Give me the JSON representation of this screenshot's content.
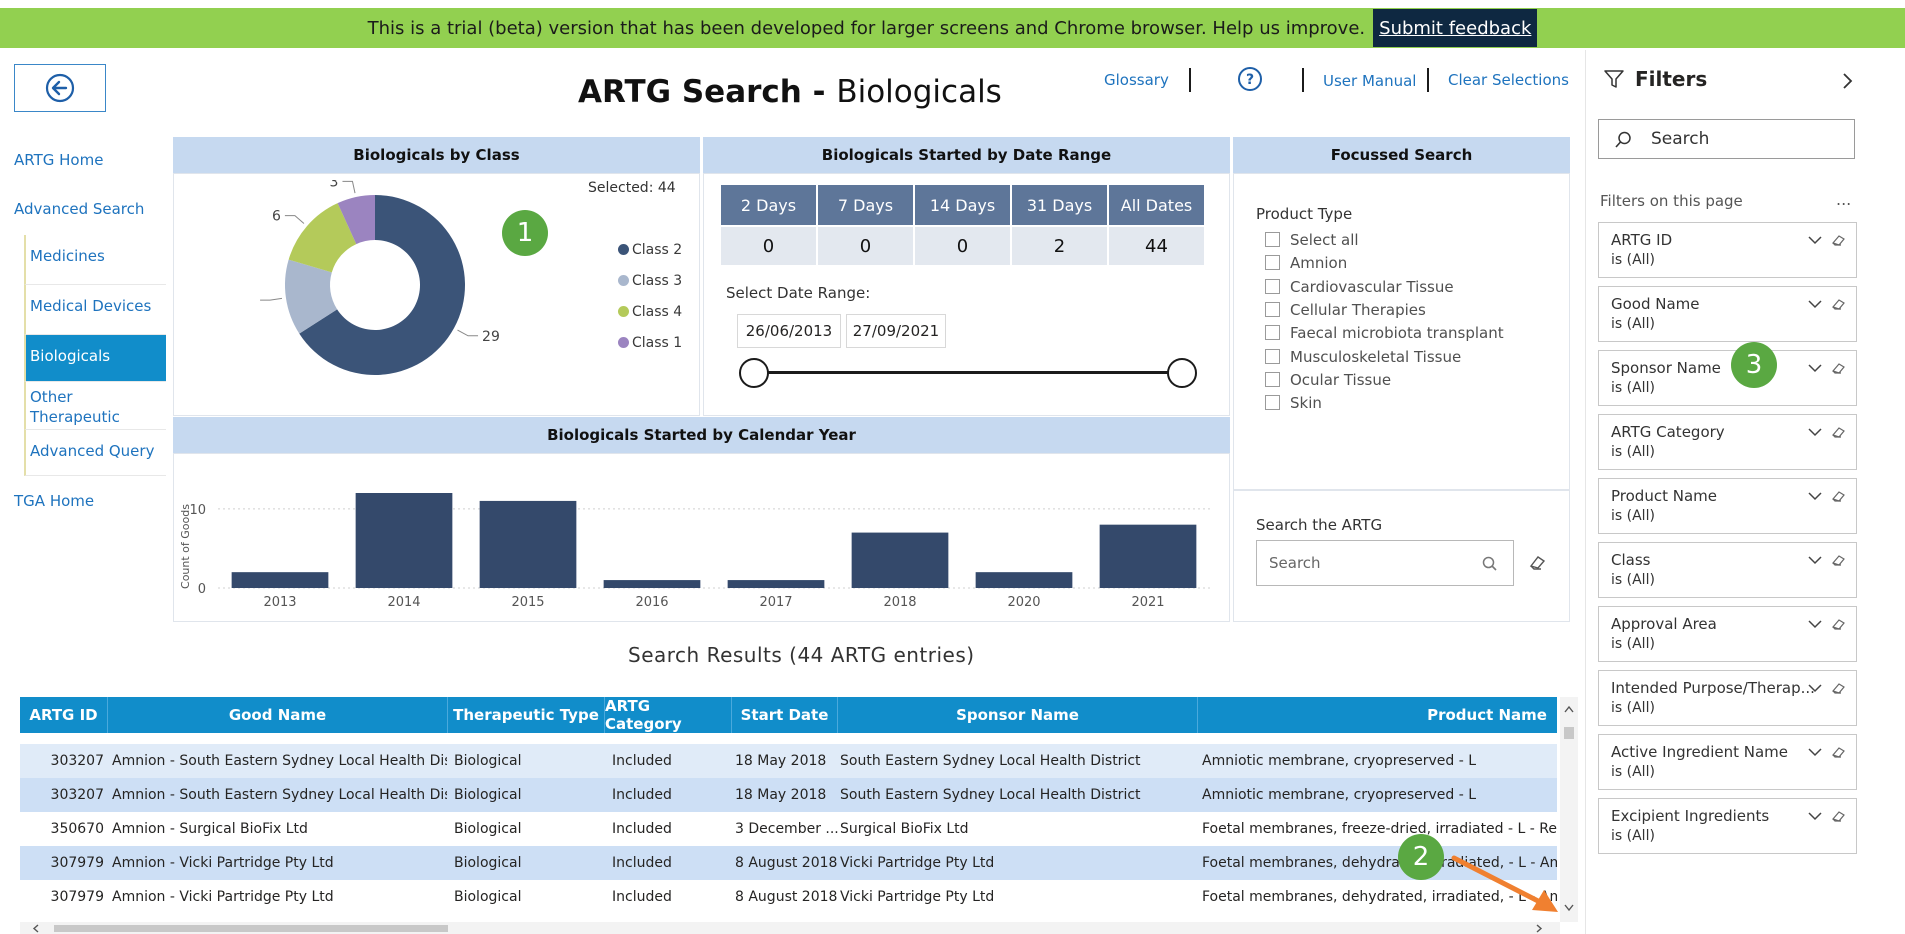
{
  "banner": {
    "text": "This is a trial (beta) version that has been developed for larger screens and Chrome browser. Help us improve.",
    "feedback_label": "Submit feedback"
  },
  "nav": {
    "artg_home": "ARTG Home",
    "advanced_search": "Advanced Search",
    "medicines": "Medicines",
    "medical_devices": "Medical Devices",
    "biologicals": "Biologicals",
    "other_goods": "Other Therapeutic Goods",
    "advanced_query": "Advanced Query",
    "tga_home": "TGA Home"
  },
  "header": {
    "title_bold": "ARTG Search - ",
    "title_rest": "Biologicals",
    "glossary": "Glossary",
    "user_manual": "User Manual",
    "clear_selections": "Clear Selections"
  },
  "by_class": {
    "title": "Biologicals by Class",
    "selected": "Selected: 44",
    "chart_data": {
      "type": "pie",
      "categories": [
        "Class 2",
        "Class 3",
        "Class 4",
        "Class 1"
      ],
      "values": [
        29,
        6,
        6,
        3
      ],
      "colors": [
        "#3b5478",
        "#a9b7cd",
        "#b4ca5a",
        "#9b84c0"
      ]
    }
  },
  "date_range": {
    "title": "Biologicals Started by Date Range",
    "headers": [
      "2 Days",
      "7 Days",
      "14 Days",
      "31 Days",
      "All Dates"
    ],
    "values": [
      "0",
      "0",
      "0",
      "2",
      "44"
    ],
    "select_label": "Select Date Range:",
    "start": "26/06/2013",
    "end": "27/09/2021"
  },
  "by_year": {
    "title": "Biologicals Started by Calendar Year",
    "chart_data": {
      "type": "bar",
      "categories": [
        "2013",
        "2014",
        "2015",
        "2016",
        "2017",
        "2018",
        "2020",
        "2021"
      ],
      "values": [
        2,
        12,
        11,
        1,
        1,
        7,
        2,
        8
      ],
      "ylabel": "Count of Goods",
      "yticks": [
        "0",
        "10"
      ],
      "ylim": [
        0,
        12
      ]
    }
  },
  "focussed": {
    "title": "Focussed Search",
    "product_type_label": "Product Type",
    "options": [
      "Select all",
      "Amnion",
      "Cardiovascular Tissue",
      "Cellular Therapies",
      "Faecal microbiota transplant",
      "Musculoskeletal Tissue",
      "Ocular Tissue",
      "Skin"
    ],
    "search_label": "Search the ARTG",
    "search_placeholder": "Search"
  },
  "results": {
    "title": "Search Results (44 ARTG entries)",
    "columns": [
      "ARTG ID",
      "Good Name",
      "Therapeutic Type",
      "ARTG Category",
      "Start Date",
      "Sponsor Name",
      "Product Name"
    ],
    "rows": [
      [
        "303207",
        "Amnion - South Eastern Sydney Local Health Dist...",
        "Biological",
        "Included",
        "18 May 2018",
        "South Eastern Sydney Local Health District",
        "Amniotic membrane, cryopreserved - L"
      ],
      [
        "303207",
        "Amnion - South Eastern Sydney Local Health Dist...",
        "Biological",
        "Included",
        "18 May 2018",
        "South Eastern Sydney Local Health District",
        "Amniotic membrane, cryopreserved - L"
      ],
      [
        "350670",
        "Amnion - Surgical BioFix Ltd",
        "Biological",
        "Included",
        "3 December ...",
        "Surgical BioFix Ltd",
        "Foetal membranes, freeze-dried, irradiated - L - Revita"
      ],
      [
        "307979",
        "Amnion - Vicki Partridge Pty Ltd",
        "Biological",
        "Included",
        "8 August 2018",
        "Vicki Partridge Pty Ltd",
        "Foetal membranes, dehydrated, irradiated, - L - Amnio"
      ],
      [
        "307979",
        "Amnion - Vicki Partridge Pty Ltd",
        "Biological",
        "Included",
        "8 August 2018",
        "Vicki Partridge Pty Ltd",
        "Foetal membranes, dehydrated, irradiated, - L - Amnio"
      ]
    ]
  },
  "filters": {
    "title": "Filters",
    "search_placeholder": "Search",
    "section_label": "Filters on this page",
    "more": "...",
    "items": [
      {
        "name": "ARTG ID",
        "value": "is (All)"
      },
      {
        "name": "Good Name",
        "value": "is (All)"
      },
      {
        "name": "Sponsor Name",
        "value": "is (All)"
      },
      {
        "name": "ARTG Category",
        "value": "is (All)"
      },
      {
        "name": "Product Name",
        "value": "is (All)"
      },
      {
        "name": "Class",
        "value": "is (All)"
      },
      {
        "name": "Approval Area",
        "value": "is (All)"
      },
      {
        "name": "Intended Purpose/Therap...",
        "value": "is (All)"
      },
      {
        "name": "Active Ingredient Name",
        "value": "is (All)"
      },
      {
        "name": "Excipient Ingredients",
        "value": "is (All)"
      }
    ]
  },
  "badges": [
    "1",
    "2",
    "3"
  ],
  "colors": {
    "banner": "#92d050",
    "table_header": "#118dca",
    "bar": "#34496b",
    "badge": "#5aa842",
    "arrow": "#f08030"
  }
}
